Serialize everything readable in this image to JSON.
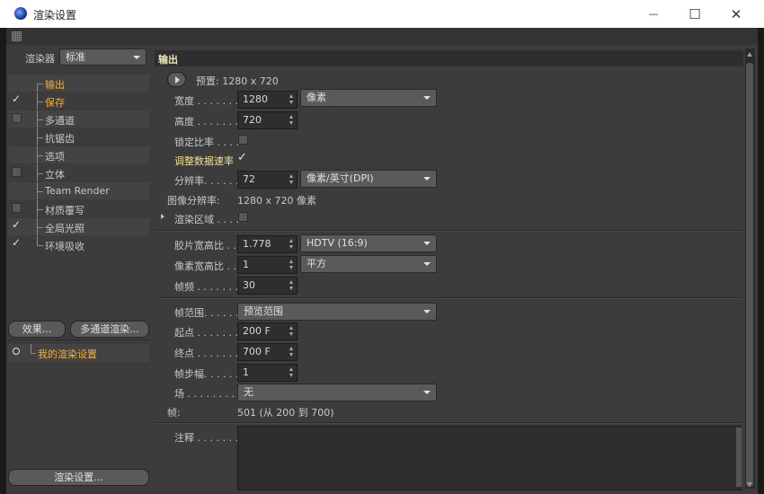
{
  "window": {
    "title": "渲染设置",
    "minimize_glyph": "—",
    "maximize_glyph": "☐",
    "close_glyph": "✕"
  },
  "left": {
    "renderer_label": "渲染器",
    "renderer_value": "标准",
    "items": [
      {
        "label": "输出",
        "checkbox": "none",
        "highlight": true
      },
      {
        "label": "保存",
        "checkbox": "ticked",
        "highlight": true
      },
      {
        "label": "多通道",
        "checkbox": "empty",
        "highlight": false
      },
      {
        "label": "抗锯齿",
        "checkbox": "none",
        "highlight": false
      },
      {
        "label": "选项",
        "checkbox": "none",
        "highlight": false
      },
      {
        "label": "立体",
        "checkbox": "empty",
        "highlight": false
      },
      {
        "label": "Team Render",
        "checkbox": "none",
        "highlight": false
      },
      {
        "label": "材质覆写",
        "checkbox": "empty",
        "highlight": false
      },
      {
        "label": "全局光照",
        "checkbox": "ticked",
        "highlight": false
      },
      {
        "label": "环境吸收",
        "checkbox": "ticked",
        "highlight": false
      }
    ],
    "effects_button": "效果...",
    "multipass_button": "多通道渲染...",
    "my_settings": "我的渲染设置",
    "render_settings_button": "渲染设置..."
  },
  "output": {
    "section_title": "输出",
    "preset": "预置: 1280 x 720",
    "width_label": "宽度 . . . . . . .",
    "width_value": "1280",
    "unit_value": "像素",
    "height_label": "高度 . . . . . . .",
    "height_value": "720",
    "lock_ratio_label": "锁定比率 . . . .",
    "adjust_rate_label": "调整数据速率",
    "adjust_rate_tick": "✓",
    "resolution_label": "分辨率. . . . . .",
    "resolution_value": "72",
    "resolution_unit": "像素/英寸(DPI)",
    "image_res_label": "图像分辨率:",
    "image_res_value": "1280 x 720 像素",
    "render_region_label": "渲染区域 . . . .",
    "film_aspect_label": "胶片宽高比 . .",
    "film_aspect_value": "1.778",
    "film_aspect_preset": "HDTV (16:9)",
    "pixel_aspect_label": "像素宽高比 . .",
    "pixel_aspect_value": "1",
    "pixel_aspect_preset": "平方",
    "fps_label": "帧频 . . . . . . .",
    "fps_value": "30",
    "frame_range_label": "帧范围. . . . . .",
    "frame_range_value": "预览范围",
    "start_label": "起点 . . . . . . .",
    "start_value": "200 F",
    "end_label": "终点 . . . . . . .",
    "end_value": "700 F",
    "step_label": "帧步幅. . . . . .",
    "step_value": "1",
    "field_label": "场 . . . . . . . . .",
    "field_value": "无",
    "frames_label": "帧:",
    "frames_value": "501 (从 200 到 700)",
    "notes_label": "注释 . . . . . . ."
  }
}
